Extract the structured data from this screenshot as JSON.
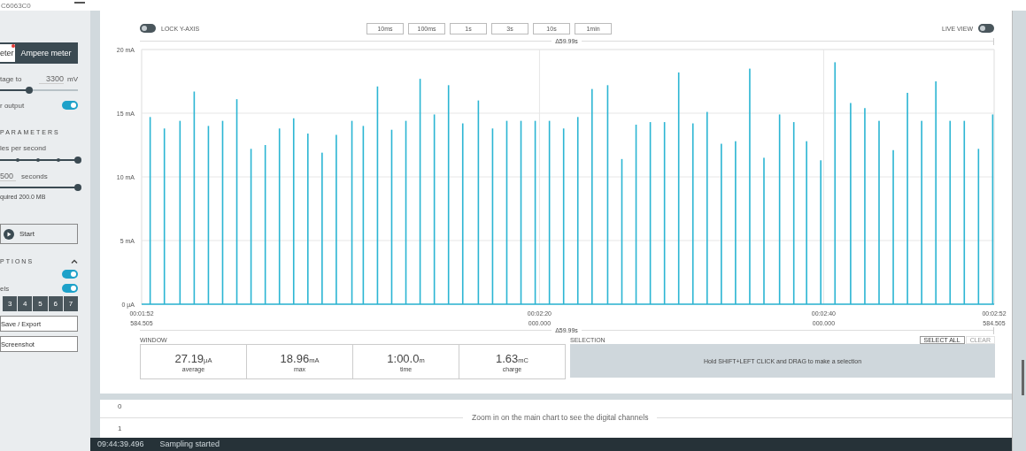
{
  "device": {
    "serial": "C6063C0"
  },
  "sidebar": {
    "mode_buttons": [
      {
        "label": "eter",
        "selected": false,
        "alert": true
      },
      {
        "label": "Ampere meter",
        "selected": true,
        "alert": false
      }
    ],
    "voltage": {
      "label": "tage to",
      "value": "3300",
      "unit": "mV",
      "level": 0.37
    },
    "power_output": {
      "label": "r output",
      "on": true
    },
    "sampling_heading": "PARAMETERS",
    "rate": {
      "label": "les per second",
      "level": 1
    },
    "duration": {
      "value": "500",
      "unit": "seconds",
      "level": 1
    },
    "memory_note": "quired 200.0 MB",
    "start_button": "Start",
    "options_heading": "PTIONS",
    "options_expanded": true,
    "toggles": [
      {
        "on": true
      },
      {
        "label": "els",
        "on": true
      }
    ],
    "channel_buttons": [
      {
        "label": "3",
        "selected": true
      },
      {
        "label": "4",
        "selected": true
      },
      {
        "label": "5",
        "selected": true
      },
      {
        "label": "6",
        "selected": true
      },
      {
        "label": "7",
        "selected": true
      }
    ],
    "buttons": [
      "Save / Export",
      "Screenshot"
    ]
  },
  "chart_panel": {
    "lock_y_axis": {
      "label": "LOCK Y-AXIS",
      "on": false
    },
    "window_buttons": [
      "10ms",
      "100ms",
      "1s",
      "3s",
      "10s",
      "1min"
    ],
    "live_view": {
      "label": "LIVE VIEW",
      "on": false
    },
    "top_span": "Δ59.99s",
    "bottom_span": "Δ59.99s",
    "chart_data": {
      "type": "bar",
      "grid": true,
      "xlim": [
        112,
        172
      ],
      "ylim": [
        0,
        20
      ],
      "yticks": [
        {
          "value": 0,
          "label": "0 µA"
        },
        {
          "value": 5,
          "label": "5 mA"
        },
        {
          "value": 10,
          "label": "10 mA"
        },
        {
          "value": 15,
          "label": "15 mA"
        },
        {
          "value": 20,
          "label": "20 mA"
        }
      ],
      "xticks": [
        {
          "value": 112,
          "label": "00:01:52"
        },
        {
          "value": 140,
          "label": "00:02:20"
        },
        {
          "value": 160,
          "label": "00:02:40"
        },
        {
          "value": 172,
          "label": "00:02:52"
        }
      ],
      "x": [
        112.6,
        113.6,
        114.7,
        115.7,
        116.7,
        117.7,
        118.7,
        119.7,
        120.7,
        121.7,
        122.7,
        123.7,
        124.7,
        125.7,
        126.8,
        127.6,
        128.6,
        129.6,
        130.6,
        131.6,
        132.6,
        133.6,
        134.6,
        135.7,
        136.7,
        137.7,
        138.7,
        139.7,
        140.7,
        141.7,
        142.7,
        143.7,
        144.8,
        145.8,
        146.8,
        147.8,
        148.8,
        149.8,
        150.8,
        151.8,
        152.8,
        153.8,
        154.8,
        155.8,
        156.9,
        157.9,
        158.8,
        159.8,
        160.8,
        161.9,
        162.9,
        163.9,
        164.9,
        165.9,
        166.9,
        167.9,
        168.9,
        169.9,
        170.9,
        171.9
      ],
      "series": [
        {
          "color": "#2bb5d3",
          "values": [
            14.7,
            13.8,
            14.4,
            16.7,
            14.0,
            14.4,
            16.1,
            12.2,
            12.5,
            13.8,
            14.6,
            13.4,
            11.9,
            13.3,
            14.4,
            14.0,
            17.1,
            13.7,
            14.4,
            17.7,
            14.9,
            17.2,
            14.2,
            16.0,
            13.8,
            14.4,
            14.4,
            14.4,
            14.4,
            13.8,
            14.7,
            16.9,
            17.2,
            11.4,
            14.1,
            14.3,
            14.3,
            18.2,
            14.2,
            15.1,
            12.6,
            12.8,
            18.5,
            11.5,
            14.9,
            14.3,
            12.8,
            11.3,
            19.0,
            15.8,
            15.4,
            14.4,
            12.1,
            16.6,
            14.4,
            17.5,
            14.4,
            14.4,
            12.2,
            14.9
          ]
        }
      ]
    },
    "x_tick_fractions": [
      "584.505",
      "000.000",
      "000.000",
      "584.505"
    ],
    "window_label": "WINDOW",
    "stats": [
      {
        "value": "27.19",
        "unit": "µA",
        "label": "average"
      },
      {
        "value": "18.96",
        "unit": "mA",
        "label": "max"
      },
      {
        "value": "1:00.0",
        "unit": "m",
        "label": "time"
      },
      {
        "value": "1.63",
        "unit": "mC",
        "label": "charge"
      }
    ],
    "selection_label": "SELECTION",
    "selection_buttons": [
      {
        "label": "SELECT ALL",
        "disabled": false
      },
      {
        "label": "CLEAR",
        "disabled": true
      }
    ],
    "selection_hint": "Hold SHIFT+LEFT CLICK and DRAG to make a selection"
  },
  "digital_panel": {
    "rows": [
      "0",
      "1"
    ],
    "message": "Zoom in on the main chart to see the digital channels"
  },
  "status_bar": {
    "time": "09:44:39.496",
    "message": "Sampling started"
  }
}
